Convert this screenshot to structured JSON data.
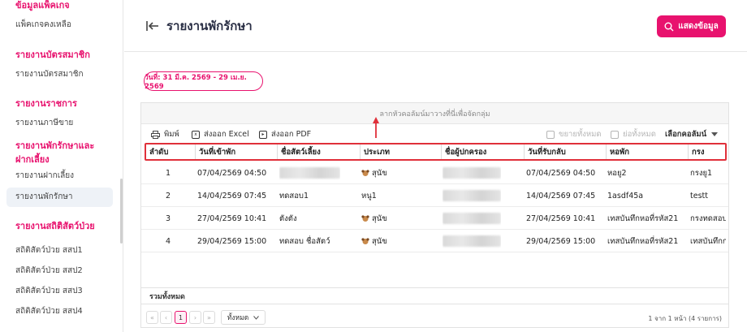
{
  "sidebar": {
    "sections": [
      {
        "title": "ข้อมูลแพ็คเกจ",
        "items": [
          "แพ็คเกจคงเหลือ"
        ]
      },
      {
        "title": "รายงานบัตรสมาชิก",
        "items": [
          "รายงานบัตรสมาชิก"
        ]
      },
      {
        "title": "รายงานราชการ",
        "items": [
          "รายงานภาษีขาย"
        ]
      },
      {
        "title": "รายงานพักรักษาและ",
        "title2": "ฝากเลี้ยง",
        "items": [
          "รายงานฝากเลี้ยง",
          "รายงานพักรักษา"
        ]
      },
      {
        "title": "รายงานสถิติสัตว์ป่วย",
        "items": [
          "สถิติสัตว์ป่วย สสป1",
          "สถิติสัตว์ป่วย สสป2",
          "สถิติสัตว์ป่วย สสป3",
          "สถิติสัตว์ป่วย สสป4"
        ]
      }
    ]
  },
  "header": {
    "title": "รายงานพักรักษา",
    "show_button": "แสดงข้อมูล"
  },
  "date_range": "วันที่: 31 มี.ค. 2569 - 29 เม.ย. 2569",
  "grid": {
    "group_hint": "ลากหัวคอลัมน์มาวางที่นี่เพื่อจัดกลุ่ม",
    "toolbar": {
      "print": "พิมพ์",
      "export_excel": "ส่งออก Excel",
      "export_pdf": "ส่งออก PDF",
      "expand_all": "ขยายทั้งหมด",
      "collapse_all": "ย่อทั้งหมด",
      "column_chooser": "เลือกคอลัมน์"
    },
    "columns": [
      "ลำดับ",
      "วันที่เข้าพัก",
      "ชื่อสัตว์เลี้ยง",
      "ประเภท",
      "ชื่อผู้ปกครอง",
      "วันที่รับกลับ",
      "หอพัก",
      "กรง"
    ],
    "rows": [
      {
        "no": "1",
        "checkin": "07/04/2569 04:50",
        "pet": "",
        "type": "สุนัข",
        "owner": "",
        "checkout": "07/04/2569 04:50",
        "ward": "หอยู2",
        "cage": "กรงยู1"
      },
      {
        "no": "2",
        "checkin": "14/04/2569 07:45",
        "pet": "ทดสอบ1",
        "type": "หนู1",
        "owner": "",
        "checkout": "14/04/2569 07:45",
        "ward": "1asdf45a",
        "cage": "testt"
      },
      {
        "no": "3",
        "checkin": "27/04/2569 10:41",
        "pet": "ตังตัง",
        "type": "สุนัข",
        "owner": "",
        "checkout": "27/04/2569 10:41",
        "ward": "เทสบันทึกหอที่รหัส21",
        "cage": "กรงทดสอบ"
      },
      {
        "no": "4",
        "checkin": "29/04/2569 15:00",
        "pet": "ทดสอบ ชื่อสัตว์",
        "type": "สุนัข",
        "owner": "",
        "checkout": "29/04/2569 15:00",
        "ward": "เทสบันทึกหอที่รหัส21",
        "cage": "เทสบันทึกก"
      }
    ],
    "summary_label": "รวมทั้งหมด",
    "pager": {
      "current_page": "1",
      "page_size": "ทั้งหมด",
      "info": "1 จาก 1 หน้า (4 รายการ)"
    }
  },
  "colors": {
    "accent": "#e8126e",
    "highlight_border": "#e0303a"
  }
}
